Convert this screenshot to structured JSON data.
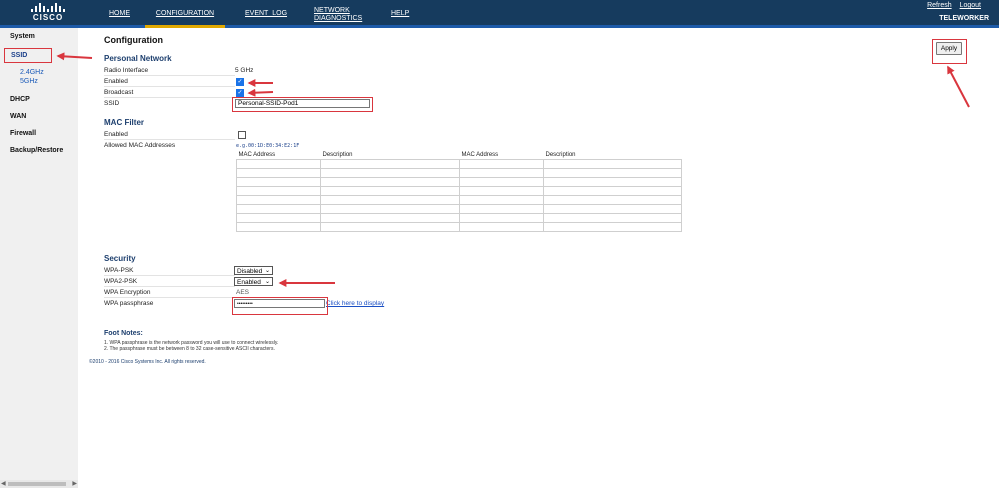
{
  "header": {
    "logo_text": "CISCO",
    "nav": [
      "HOME",
      "CONFIGURATION",
      "EVENT_LOG",
      "NETWORK DIAGNOSTICS",
      "HELP"
    ],
    "refresh_label": "Refresh",
    "logout_label": "Logout",
    "site_name": "TELEWORKER",
    "bg_color": "#163b5e",
    "active_tab_color": "#e0a800"
  },
  "sidebar": {
    "items": [
      "System",
      "SSID",
      "DHCP",
      "WAN",
      "Firewall",
      "Backup/Restore"
    ],
    "ssid_subitems": [
      "2.4GHz",
      "5GHz"
    ]
  },
  "page": {
    "title": "Configuration",
    "apply_label": "Apply"
  },
  "personal_network": {
    "heading": "Personal Network",
    "radio_interface_label": "Radio Interface",
    "radio_interface_value": "5 GHz",
    "enabled_label": "Enabled",
    "enabled_checked": true,
    "broadcast_label": "Broadcast",
    "broadcast_checked": true,
    "ssid_label": "SSID",
    "ssid_value": "Personal-SSID-Pod1"
  },
  "mac_filter": {
    "heading": "MAC Filter",
    "enabled_label": "Enabled",
    "enabled_checked": false,
    "allowed_label": "Allowed MAC Addresses",
    "hint": "e.g.00:1D:E0:34:E2:1F",
    "columns": [
      "MAC Address",
      "Description",
      "MAC Address",
      "Description"
    ],
    "row_count": 8
  },
  "security": {
    "heading": "Security",
    "wpa_psk_label": "WPA-PSK",
    "wpa_psk_value": "Disabled",
    "wpa2_psk_label": "WPA2-PSK",
    "wpa2_psk_value": "Enabled",
    "encryption_label": "WPA Encryption",
    "encryption_value": "AES",
    "passphrase_label": "WPA passphrase",
    "passphrase_value": "•••••••••",
    "display_link": "Click here to display"
  },
  "footnotes": {
    "title": "Foot Notes:",
    "items": [
      "1.  WPA passphrase is the network password you will use to connect wirelessly.",
      "2.  The passphrase must be between 8 to 32 case-sensitive ASCII characters."
    ],
    "copyright": "©2010 - 2016 Cisco Systems Inc. All rights reserved."
  },
  "annotation_color": "#d9363e"
}
